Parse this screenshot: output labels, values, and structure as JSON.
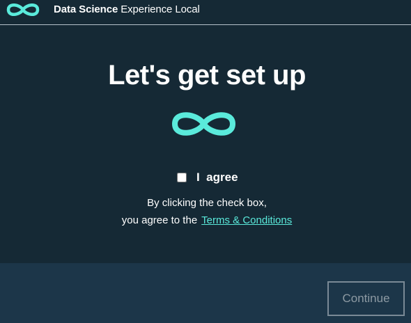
{
  "header": {
    "brand": "Data Science",
    "product": " Experience Local",
    "logo_icon": "infinity-logo-icon"
  },
  "main": {
    "title": "Let's get set up",
    "logo_icon": "infinity-logo-icon",
    "agree_label": "I  agree",
    "agree_checked": false,
    "info_line1": "By clicking the check box,",
    "info_line2": "you agree to the",
    "terms_link": "Terms & Conditions"
  },
  "footer": {
    "continue_label": "Continue",
    "continue_disabled": true
  },
  "colors": {
    "background": "#152935",
    "footer_background": "#1c3649",
    "accent": "#5aeadb",
    "header_divider": "#b7c3cc",
    "disabled": "#8d9aa3"
  }
}
